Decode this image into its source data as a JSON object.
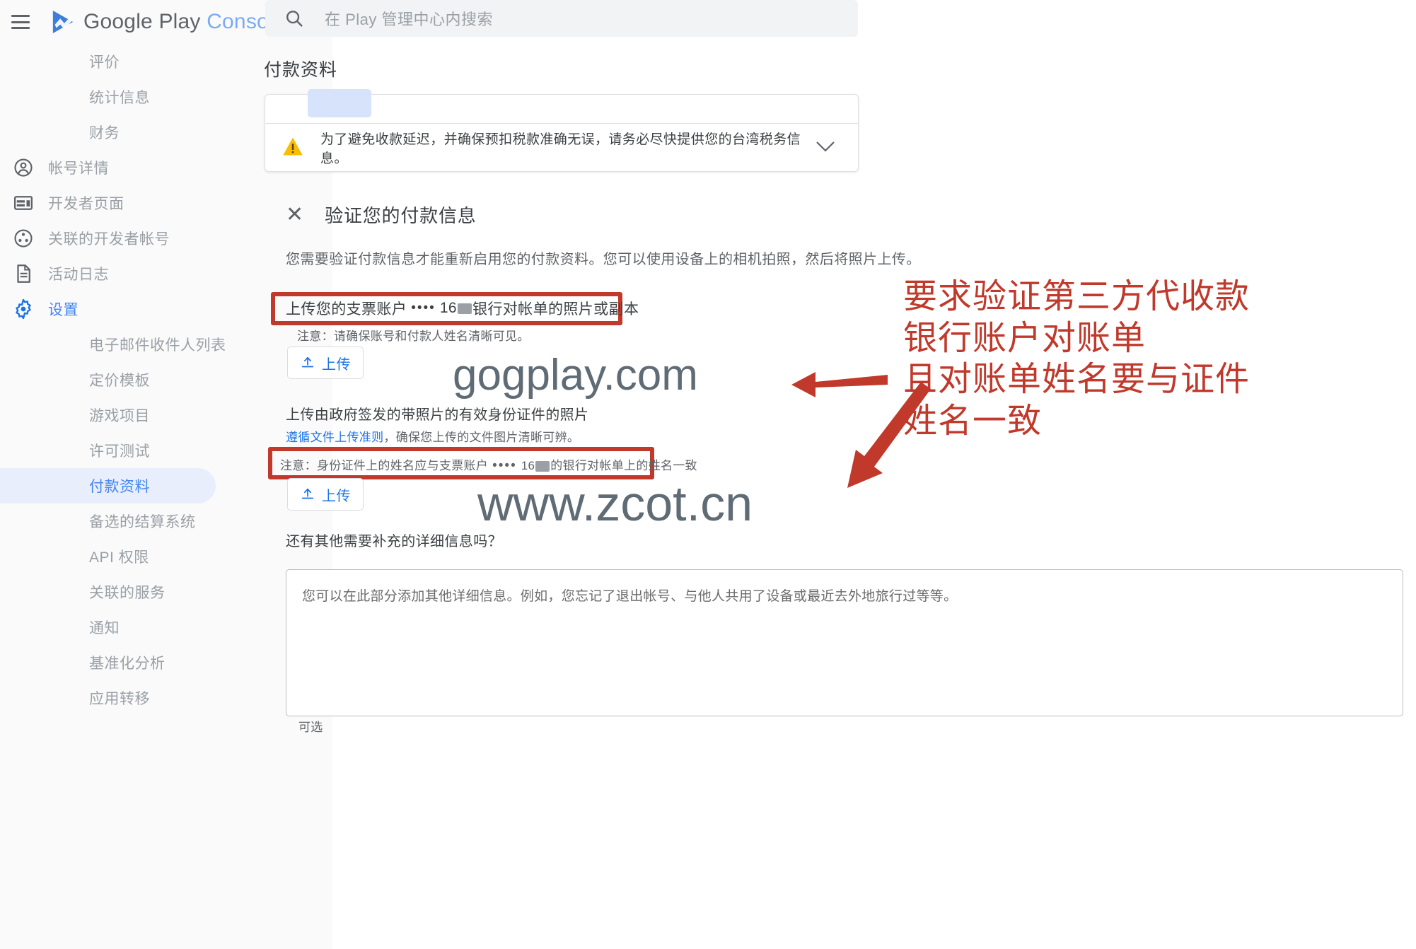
{
  "brand": {
    "name_primary": "Google Play",
    "name_secondary": "Console",
    "menu_icon": "hamburger-icon",
    "logo_icon": "google-play-logo"
  },
  "search": {
    "placeholder": "在 Play 管理中心内搜索",
    "icon": "search-icon"
  },
  "page": {
    "title": "付款资料"
  },
  "sidebar": {
    "items": [
      {
        "label": "评价",
        "icon": "",
        "child": true,
        "state": "normal"
      },
      {
        "label": "统计信息",
        "icon": "",
        "child": true,
        "state": "normal"
      },
      {
        "label": "财务",
        "icon": "",
        "child": true,
        "state": "normal"
      },
      {
        "label": "帐号详情",
        "icon": "account-icon",
        "child": false,
        "state": "normal"
      },
      {
        "label": "开发者页面",
        "icon": "developer-page-icon",
        "child": false,
        "state": "normal"
      },
      {
        "label": "关联的开发者帐号",
        "icon": "linked-accounts-icon",
        "child": false,
        "state": "normal"
      },
      {
        "label": "活动日志",
        "icon": "activity-log-icon",
        "child": false,
        "state": "normal"
      },
      {
        "label": "设置",
        "icon": "gear-icon",
        "child": false,
        "state": "active"
      },
      {
        "label": "电子邮件收件人列表",
        "icon": "",
        "child": true,
        "state": "normal"
      },
      {
        "label": "定价模板",
        "icon": "",
        "child": true,
        "state": "normal"
      },
      {
        "label": "游戏项目",
        "icon": "",
        "child": true,
        "state": "normal"
      },
      {
        "label": "许可测试",
        "icon": "",
        "child": true,
        "state": "normal"
      },
      {
        "label": "付款资料",
        "icon": "",
        "child": true,
        "state": "selected"
      },
      {
        "label": "备选的结算系统",
        "icon": "",
        "child": true,
        "state": "normal"
      },
      {
        "label": "API 权限",
        "icon": "",
        "child": true,
        "state": "normal"
      },
      {
        "label": "关联的服务",
        "icon": "",
        "child": true,
        "state": "normal"
      },
      {
        "label": "通知",
        "icon": "",
        "child": true,
        "state": "normal"
      },
      {
        "label": "基准化分析",
        "icon": "",
        "child": true,
        "state": "normal"
      },
      {
        "label": "应用转移",
        "icon": "",
        "child": true,
        "state": "normal"
      }
    ]
  },
  "banner": {
    "icon": "warning-triangle-icon",
    "text": "为了避免收款延迟，并确保预扣税款准确无误，请务必尽快提供您的台湾税务信息。",
    "expand_icon": "chevron-down-icon"
  },
  "verification": {
    "close_icon": "close-x-icon",
    "heading": "验证您的付款信息",
    "description": "您需要验证付款信息才能重新启用您的付款资料。您可以使用设备上的相机拍照，然后将照片上传。",
    "statement": {
      "label_prefix": "上传您的支票账户",
      "account_dots": "••••",
      "account_digits": "16",
      "label_suffix": "银行对帐单的照片或副本",
      "note": "注意：请确保账号和付款人姓名清晰可见。",
      "upload_label": "上传",
      "upload_icon": "upload-icon"
    },
    "identity": {
      "label": "上传由政府签发的带照片的有效身份证件的照片",
      "sub_link": "遵循文件上传准则",
      "sub_rest": "，确保您上传的文件图片清晰可辨。",
      "note_prefix": "注意：身份证件上的姓名应与支票账户",
      "note_dots": "••••",
      "note_digits": "16",
      "note_suffix": "的银行对帐单上的姓名一致",
      "upload_label": "上传",
      "upload_icon": "upload-icon"
    },
    "extra": {
      "question": "还有其他需要补充的详细信息吗？",
      "placeholder": "您可以在此部分添加其他详细信息。例如，您忘记了退出帐号、与他人共用了设备或最近去外地旅行过等等。",
      "optional_label": "可选"
    }
  },
  "annotation": {
    "color": "#c0392b",
    "lines": [
      "要求验证第三方代收款",
      "银行账户对账单",
      "且对账单姓名要与证件",
      "姓名一致"
    ],
    "arrow_top_icon": "left-arrow-icon",
    "arrow_bottom_icon": "down-left-arrow-icon"
  },
  "watermarks": {
    "first": "gogplay.com",
    "second": "www.zcot.cn"
  }
}
